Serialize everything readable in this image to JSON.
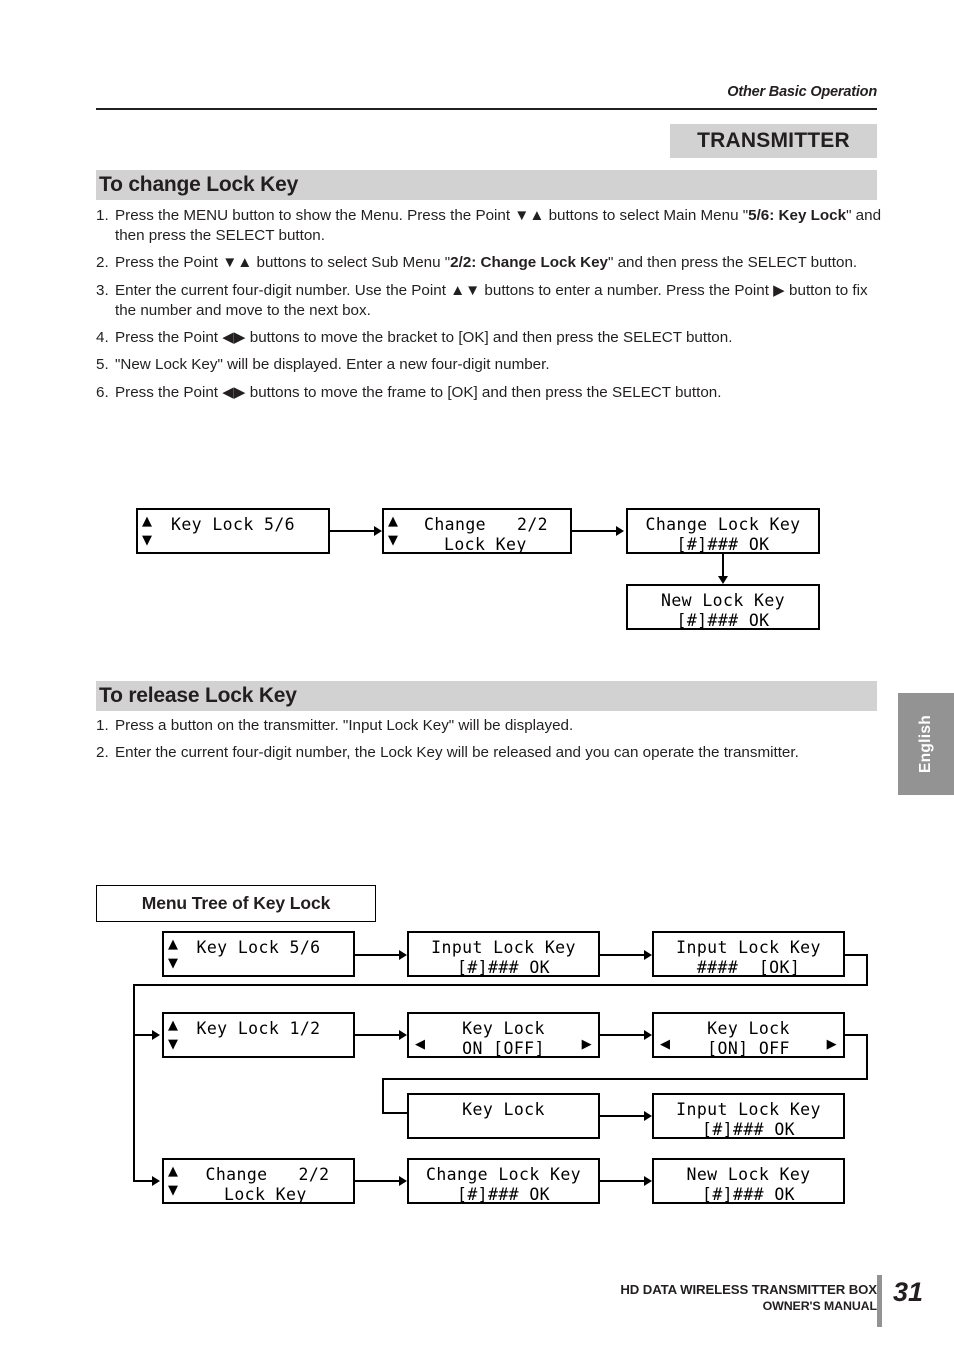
{
  "header": {
    "running_head": "Other Basic Operation",
    "section_band": "TRANSMITTER"
  },
  "sections": [
    {
      "heading": "To change Lock Key",
      "steps": [
        {
          "num": "1.",
          "html": "Press the MENU button to show the Menu. Press the Point ▼▲ buttons to select Main Menu \"<b>5/6: Key Lock</b>\"  and then press the SELECT button."
        },
        {
          "num": "2.",
          "html": "Press the Point ▼▲ buttons to select Sub Menu \"<b>2/2: Change Lock Key</b>\" and then press the SELECT button."
        },
        {
          "num": "3.",
          "html": "Enter the current four-digit number. Use the Point ▲▼ buttons to enter a number. Press the Point ▶ button to fix the number and move to the next box."
        },
        {
          "num": "4.",
          "html": "Press the Point ◀▶ buttons to move the bracket to [OK] and then press the SELECT button."
        },
        {
          "num": "5.",
          "html": "\"New Lock Key\" will be displayed. Enter a new four-digit number."
        },
        {
          "num": "6.",
          "html": "Press the Point ◀▶ buttons to move the frame to [OK] and then press the SELECT button."
        }
      ]
    },
    {
      "heading": "To release Lock Key",
      "steps": [
        {
          "num": "1.",
          "html": "Press a button on the transmitter. \"Input Lock Key\" will be displayed."
        },
        {
          "num": "2.",
          "html": "Enter the current four-digit number, the Lock Key will be released and you can operate the transmitter."
        }
      ]
    }
  ],
  "change_flow": {
    "boxes": [
      {
        "id": "cf1",
        "line1": "Key Lock 5/6",
        "line2": "",
        "arrows": "updown"
      },
      {
        "id": "cf2",
        "line1": "Change   2/2",
        "line2": "Lock Key",
        "arrows": "updown"
      },
      {
        "id": "cf3",
        "line1": "Change Lock Key",
        "line2": "[#]### OK",
        "arrows": "none"
      },
      {
        "id": "cf4",
        "line1": "New Lock Key",
        "line2": "[#]### OK",
        "arrows": "none"
      }
    ]
  },
  "menu_tree": {
    "title": "Menu Tree of Key Lock",
    "boxes": [
      {
        "id": "mt1",
        "line1": "Key Lock 5/6",
        "line2": "",
        "arrows": "updown"
      },
      {
        "id": "mt2",
        "line1": "Input Lock Key",
        "line2": "[#]### OK",
        "arrows": "none"
      },
      {
        "id": "mt3",
        "line1": "Input Lock Key",
        "line2": "####  [OK]",
        "arrows": "none"
      },
      {
        "id": "mt4",
        "line1": "Key Lock 1/2",
        "line2": "",
        "arrows": "updown"
      },
      {
        "id": "mt5",
        "line1": "Key Lock",
        "line2": "ON [OFF]",
        "arrows": "leftright"
      },
      {
        "id": "mt6",
        "line1": "Key Lock",
        "line2": "[ON] OFF",
        "arrows": "leftright"
      },
      {
        "id": "mt7",
        "line1": "Key Lock",
        "line2": "",
        "arrows": "none"
      },
      {
        "id": "mt8",
        "line1": "Input Lock Key",
        "line2": "[#]### OK",
        "arrows": "none"
      },
      {
        "id": "mt9",
        "line1": "Change   2/2",
        "line2": "Lock Key",
        "arrows": "updown"
      },
      {
        "id": "mt10",
        "line1": "Change Lock Key",
        "line2": "[#]### OK",
        "arrows": "none"
      },
      {
        "id": "mt11",
        "line1": "New Lock Key",
        "line2": "[#]### OK",
        "arrows": "none"
      }
    ]
  },
  "footer": {
    "line1": "HD DATA WIRELESS TRANSMITTER BOX",
    "line2": "OWNER'S MANUAL",
    "page": "31",
    "side_tab": "English"
  },
  "icons": {
    "up_triangle": "▲",
    "down_triangle": "▼",
    "left_triangle": "◀",
    "right_triangle": "▶"
  },
  "colors": {
    "band_grey": "#d2d2d2",
    "tab_grey": "#939393",
    "ink": "#231f20"
  }
}
